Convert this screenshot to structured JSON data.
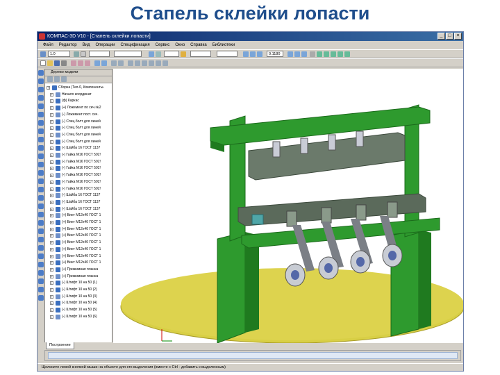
{
  "slide": {
    "title": "Стапель склейки лопасти"
  },
  "window": {
    "title": "КОМПАС-3D V10 - [Стапель склейки лопасти]",
    "buttons": {
      "minimize": "_",
      "maximize": "□",
      "close": "×"
    }
  },
  "menubar": [
    "Файл",
    "Редактор",
    "Вид",
    "Операции",
    "Спецификация",
    "Сервис",
    "Окно",
    "Справка",
    "Библиотеки"
  ],
  "toolbar": {
    "scale_value": "1.0",
    "zoom_value": "0.1180"
  },
  "tree": {
    "title": "Дерево модели",
    "items": [
      {
        "label": "Сборка (Тел-0, Компоненты-",
        "level": 0
      },
      {
        "label": "Начало координат",
        "level": 1
      },
      {
        "label": "(ф) Каркас",
        "level": 1
      },
      {
        "label": "(+) Ложемент по сеч.№2",
        "level": 1
      },
      {
        "label": "(-) Ложемент пост. сеч.",
        "level": 1
      },
      {
        "label": "(-) Спец.болт для линей",
        "level": 1
      },
      {
        "label": "(-) Спец болт для линей",
        "level": 1
      },
      {
        "label": "(-) Спец болт для линей",
        "level": 1
      },
      {
        "label": "(-) Спец болт для линей",
        "level": 1
      },
      {
        "label": "(-) Шайба 16 ГОСТ 1137",
        "level": 1
      },
      {
        "label": "(-) Гайка М16 ГОСТ 592!",
        "level": 1
      },
      {
        "label": "(-) Гайка М16 ГОСТ 592!",
        "level": 1
      },
      {
        "label": "(-) Гайка М16 ГОСТ 592!",
        "level": 1
      },
      {
        "label": "(-) Гайка М16 ГОСТ 592!",
        "level": 1
      },
      {
        "label": "(-) Гайка М16 ГОСТ 592!",
        "level": 1
      },
      {
        "label": "(-) Гайка М16 ГОСТ 592!",
        "level": 1
      },
      {
        "label": "(-) Шайба 16 ГОСТ 1137",
        "level": 1
      },
      {
        "label": "(-) Шайба 16 ГОСТ 1137",
        "level": 1
      },
      {
        "label": "(-) Шайба 16 ГОСТ 1137",
        "level": 1
      },
      {
        "label": "(+) Винт М12х40 ГОСТ 1",
        "level": 1
      },
      {
        "label": "(+) Винт М12х40 ГОСТ 1",
        "level": 1
      },
      {
        "label": "(+) Винт М12х40 ГОСТ 1",
        "level": 1
      },
      {
        "label": "(+) Винт М12х40 ГОСТ 1",
        "level": 1
      },
      {
        "label": "(+) Винт М12х40 ГОСТ 1",
        "level": 1
      },
      {
        "label": "(+) Винт М12х40 ГОСТ 1",
        "level": 1
      },
      {
        "label": "(+) Винт М12х40 ГОСТ 1",
        "level": 1
      },
      {
        "label": "(+) Винт М12х40 ГОСТ 1",
        "level": 1
      },
      {
        "label": "(+) Прижимная планка",
        "level": 1
      },
      {
        "label": "(+) Прижимная планка",
        "level": 1
      },
      {
        "label": "(-) Штифт 10 на 50 (1)",
        "level": 1
      },
      {
        "label": "(-) Штифт 10 на 50 (2)",
        "level": 1
      },
      {
        "label": "(-) Штифт 10 на 50 (3)",
        "level": 1
      },
      {
        "label": "(-) Штифт 10 на 50 (4)",
        "level": 1
      },
      {
        "label": "(-) Штифт 10 на 50 (5)",
        "level": 1
      },
      {
        "label": "(-) Штифт 10 на 50 (6)",
        "level": 1
      }
    ]
  },
  "tabs": [
    {
      "label": "Построение"
    }
  ],
  "statusbar": {
    "text": "Щелкните левой кнопкой мыши на объекте для его выделения (вместе с Ctrl - добавить к выделенным)"
  },
  "colors": {
    "frame_green": "#2e9a2e",
    "plate_yellow": "#d8cf45",
    "title_blue": "#1f4e8c"
  }
}
